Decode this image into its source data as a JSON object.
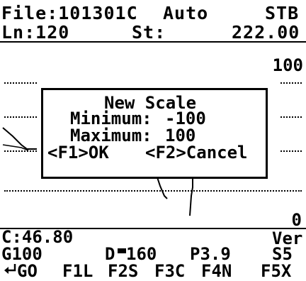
{
  "header": {
    "file_label": "File:101301C",
    "mode": "Auto",
    "corner": "STB",
    "line_label": "Ln:120",
    "station_label": "St:",
    "station_value": "222.00"
  },
  "plot": {
    "scale_max_label": "100",
    "scale_min_label": "0"
  },
  "dialog": {
    "title": "New Scale",
    "minimum_label": "Minimum:",
    "minimum_value": "-100",
    "maximum_label": "Maximum:",
    "maximum_value": "100",
    "ok_button": "<F1>OK",
    "cancel_button": "<F2>Cancel"
  },
  "status": {
    "reading": "C:46.80",
    "direction": "Ver",
    "gain": "G100",
    "depth_prefix": "D",
    "depth_value": "160",
    "param": "P3.9",
    "speed": "S5"
  },
  "softkeys": {
    "go": "GO",
    "f1": "F1L",
    "f2": "F2S",
    "f3": "F3C",
    "f4": "F4N",
    "f5": "F5X"
  }
}
